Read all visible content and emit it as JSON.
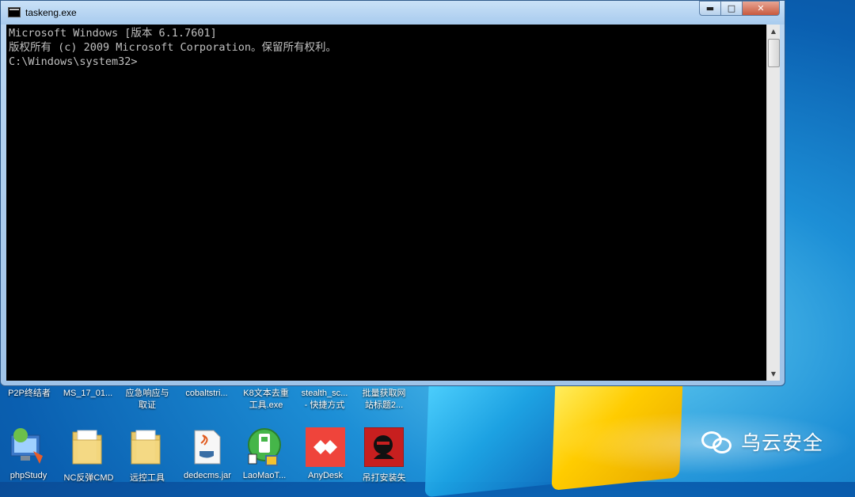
{
  "window": {
    "title": "taskeng.exe",
    "minimize_glyph": "▬",
    "maximize_glyph": "□",
    "close_glyph": "✕"
  },
  "console": {
    "lines": [
      "Microsoft Windows [版本 6.1.7601]",
      "版权所有 (c) 2009 Microsoft Corporation。保留所有权利。",
      "",
      "C:\\Windows\\system32>"
    ]
  },
  "desktop": {
    "labels_row": [
      [
        "P2P终结者",
        ""
      ],
      [
        "MS_17_01...",
        ""
      ],
      [
        "应急响应与",
        "取证"
      ],
      [
        "cobaltstri...",
        ""
      ],
      [
        "K8文本去重",
        "工具.exe"
      ],
      [
        "stealth_sc...",
        "- 快捷方式"
      ],
      [
        "批量获取网",
        "站标题2..."
      ]
    ],
    "bottom_icons": [
      {
        "label": "phpStudy",
        "icon": "phpstudy-icon"
      },
      {
        "label": "NC反弹CMD",
        "icon": "folder-icon"
      },
      {
        "label": "远控工具",
        "icon": "folder-icon"
      },
      {
        "label": "dedecms.jar",
        "icon": "java-jar-icon"
      },
      {
        "label": "LaoMaoT...",
        "icon": "usb-tool-icon"
      },
      {
        "label": "AnyDesk",
        "icon": "anydesk-icon"
      },
      {
        "label": "吊打安装失",
        "icon": "hacker-icon"
      }
    ]
  },
  "watermark": {
    "text": "乌云安全",
    "icon": "wechat-icon"
  }
}
